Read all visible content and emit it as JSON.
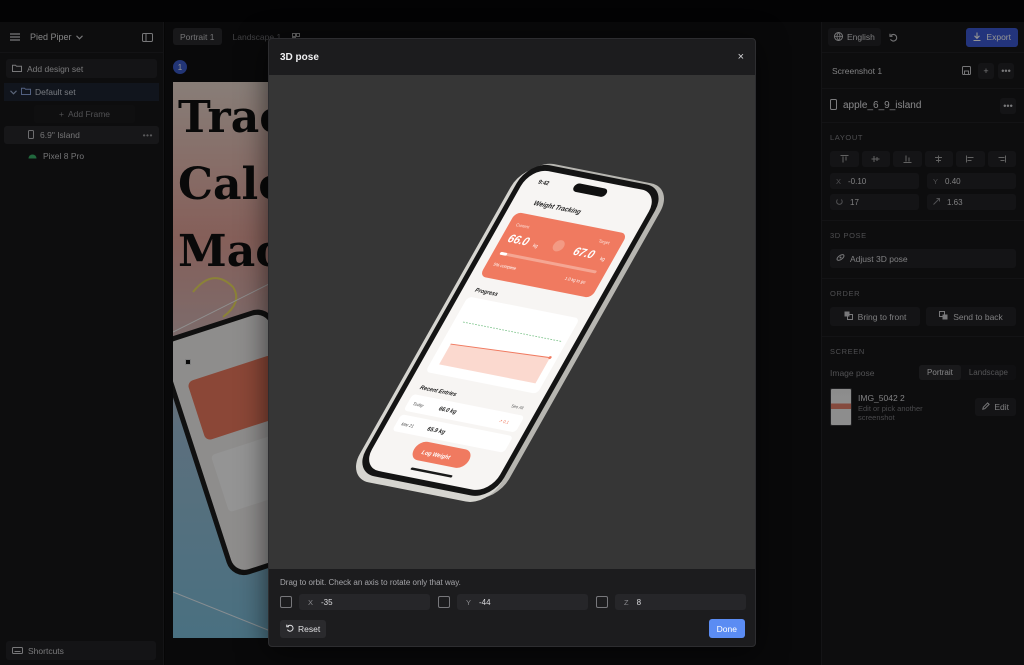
{
  "left": {
    "project_name": "Pied Piper",
    "add_design_set": "Add design set",
    "set_name": "Default set",
    "add_frame": "Add Frame",
    "frames": [
      "6.9\" Island",
      "Pixel 8 Pro"
    ],
    "shortcuts": "Shortcuts"
  },
  "canvas": {
    "tabs": [
      {
        "label": "Portrait",
        "count": "1"
      },
      {
        "label": "Landscape",
        "count": "1"
      }
    ],
    "frame_badge": "1",
    "preview_lines": [
      "Trac",
      "Calo",
      "Mac"
    ]
  },
  "right": {
    "language": "English",
    "export": "Export",
    "screenshot_name": "Screenshot 1",
    "device": "apple_6_9_island",
    "layout_title": "LAYOUT",
    "layout_fields": [
      {
        "label": "X",
        "value": "-0.10"
      },
      {
        "label": "Y",
        "value": "0.40"
      },
      {
        "label": "",
        "value": "17"
      },
      {
        "label": "",
        "value": "1.63"
      }
    ],
    "pose_title": "3D POSE",
    "adjust_pose": "Adjust 3D pose",
    "order_title": "ORDER",
    "bring_front": "Bring to front",
    "send_back": "Send to back",
    "screen_title": "SCREEN",
    "image_pose_label": "Image pose",
    "pose_options": [
      "Portrait",
      "Landscape"
    ],
    "image_name": "IMG_5042 2",
    "image_sub": "Edit or pick another screenshot",
    "edit": "Edit"
  },
  "modal": {
    "title": "3D pose",
    "close": "×",
    "hint": "Drag to orbit. Check an axis to rotate only that way.",
    "axes": [
      {
        "label": "X",
        "value": "-35"
      },
      {
        "label": "Y",
        "value": "-44"
      },
      {
        "label": "Z",
        "value": "8"
      }
    ],
    "reset": "Reset",
    "done": "Done"
  },
  "phone": {
    "time": "9:42",
    "title": "Weight Tracking",
    "current_label": "Current",
    "current_value": "66.0",
    "unit": "kg",
    "target_label": "Target",
    "target_value": "67.0",
    "card_left": "5% complete",
    "card_right": "1.0 kg to go",
    "progress_title": "Progress",
    "recent_title": "Recent Entries",
    "see_all": "See All",
    "entries": [
      {
        "date": "Today",
        "weight": "66.0 kg",
        "delta": "↗ 0.1"
      },
      {
        "date": "Mar 21",
        "weight": "65.9 kg",
        "delta": ""
      }
    ],
    "log_button": "Log Weight"
  },
  "colors": {
    "accent": "#3d5bd6",
    "done": "#5b8cf3",
    "phone_accent": "#f07a60"
  }
}
